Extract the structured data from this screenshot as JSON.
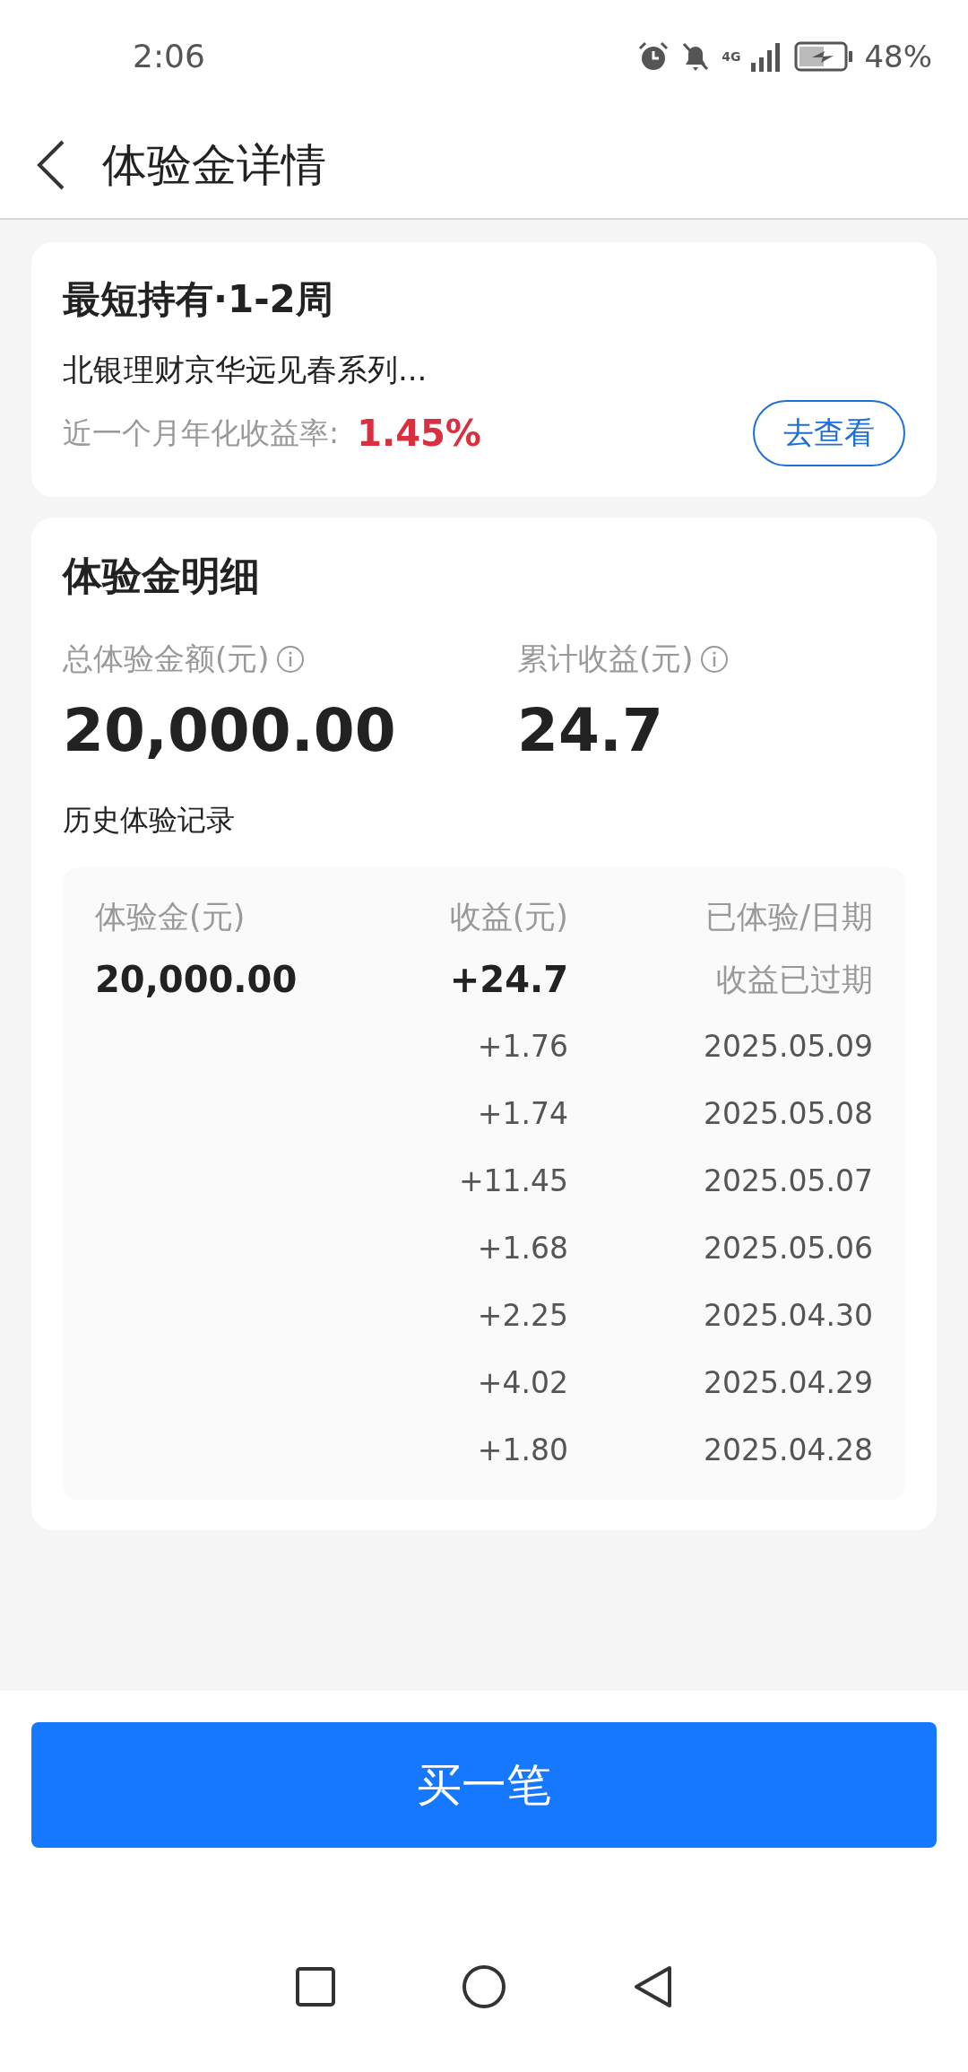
{
  "status_bar": {
    "time": "2:06",
    "network": "4G",
    "battery": "48%"
  },
  "header": {
    "title": "体验金详情"
  },
  "product": {
    "title": "最短持有·1-2周",
    "name": "北银理财京华远见春系列...",
    "rate_label": "近一个月年化收益率:",
    "rate_value": "1.45%",
    "button": "去查看"
  },
  "detail": {
    "title": "体验金明细",
    "stats": [
      {
        "label": "总体验金额(元)",
        "value": "20,000.00"
      },
      {
        "label": "累计收益(元)",
        "value": "24.7"
      }
    ],
    "history_title": "历史体验记录",
    "table": {
      "columns": [
        "体验金(元)",
        "收益(元)",
        "已体验/日期"
      ],
      "summary": {
        "amount": "20,000.00",
        "income": "+24.7",
        "status": "收益已过期"
      },
      "rows": [
        {
          "income": "+1.76",
          "date": "2025.05.09"
        },
        {
          "income": "+1.74",
          "date": "2025.05.08"
        },
        {
          "income": "+11.45",
          "date": "2025.05.07"
        },
        {
          "income": "+1.68",
          "date": "2025.05.06"
        },
        {
          "income": "+2.25",
          "date": "2025.04.30"
        },
        {
          "income": "+4.02",
          "date": "2025.04.29"
        },
        {
          "income": "+1.80",
          "date": "2025.04.28"
        }
      ]
    }
  },
  "buy_button": "买一笔"
}
